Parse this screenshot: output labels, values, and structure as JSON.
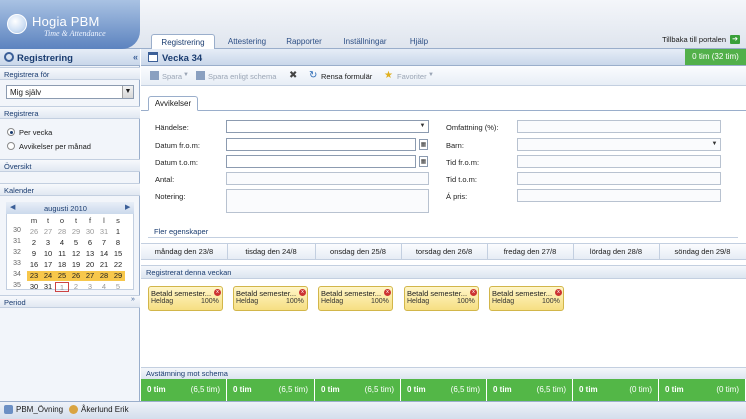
{
  "app": {
    "name": "Hogia PBM",
    "subtitle": "Time & Attendance",
    "tabs": [
      "Registrering",
      "Attestering",
      "Rapporter",
      "Inställningar",
      "Hjälp"
    ],
    "back_link": "Tillbaka till portalen"
  },
  "sidebar": {
    "title": "Registrering",
    "section_registrera_for": "Registrera för",
    "select_value": "Mig själv",
    "section_registrera": "Registrera",
    "radio_per_vecka": "Per vecka",
    "radio_avvikelser": "Avvikelser per månad",
    "section_oversikt": "Översikt",
    "section_kalender": "Kalender",
    "section_period": "Period",
    "calendar": {
      "month": "augusti 2010",
      "weekdays": [
        "m",
        "t",
        "o",
        "t",
        "f",
        "l",
        "s"
      ],
      "weeks": [
        {
          "wk": "30",
          "days": [
            "26",
            "27",
            "28",
            "29",
            "30",
            "31",
            "1"
          ]
        },
        {
          "wk": "31",
          "days": [
            "2",
            "3",
            "4",
            "5",
            "6",
            "7",
            "8"
          ]
        },
        {
          "wk": "32",
          "days": [
            "9",
            "10",
            "11",
            "12",
            "13",
            "14",
            "15"
          ]
        },
        {
          "wk": "33",
          "days": [
            "16",
            "17",
            "18",
            "19",
            "20",
            "21",
            "22"
          ]
        },
        {
          "wk": "34",
          "days": [
            "23",
            "24",
            "25",
            "26",
            "27",
            "28",
            "29"
          ]
        },
        {
          "wk": "35",
          "days": [
            "30",
            "31",
            "1",
            "2",
            "3",
            "4",
            "5"
          ]
        }
      ]
    }
  },
  "main": {
    "title": "Vecka 34",
    "total": "0 tim (32 tim)",
    "toolbar": {
      "spara": "Spara",
      "spara_schema": "Spara enligt schema",
      "rensa": "Rensa formulär",
      "favoriter": "Favoriter"
    },
    "subtab": "Avvikelser",
    "form": {
      "handelse": "Händelse:",
      "datum_from": "Datum fr.o.m:",
      "datum_tom": "Datum t.o.m:",
      "antal": "Antal:",
      "notering": "Notering:",
      "omfattning": "Omfattning (%):",
      "barn": "Barn:",
      "tid_from": "Tid fr.o.m:",
      "tid_tom": "Tid t.o.m:",
      "a_pris": "Á pris:"
    },
    "fler": "Fler egenskaper",
    "days": [
      "måndag den 23/8",
      "tisdag den 24/8",
      "onsdag den 25/8",
      "torsdag den 26/8",
      "fredag den 27/8",
      "lördag den 28/8",
      "söndag den 29/8"
    ],
    "registered_header": "Registrerat denna veckan",
    "cards": [
      {
        "title": "Betald semester...",
        "type": "Heldag",
        "pct": "100%"
      },
      {
        "title": "Betald semester...",
        "type": "Heldag",
        "pct": "100%"
      },
      {
        "title": "Betald semester...",
        "type": "Heldag",
        "pct": "100%"
      },
      {
        "title": "Betald semester...",
        "type": "Heldag",
        "pct": "100%"
      },
      {
        "title": "Betald semester...",
        "type": "Heldag",
        "pct": "100%"
      }
    ],
    "avst_header": "Avstämning mot schema",
    "avst": [
      {
        "a": "0 tim",
        "b": "(6,5 tim)"
      },
      {
        "a": "0 tim",
        "b": "(6,5 tim)"
      },
      {
        "a": "0 tim",
        "b": "(6,5 tim)"
      },
      {
        "a": "0 tim",
        "b": "(6,5 tim)"
      },
      {
        "a": "0 tim",
        "b": "(6,5 tim)"
      },
      {
        "a": "0 tim",
        "b": "(0 tim)"
      },
      {
        "a": "0 tim",
        "b": "(0 tim)"
      }
    ]
  },
  "footer": {
    "company": "PBM_Övning",
    "user": "Åkerlund Erik"
  },
  "colors": {
    "accent": "#1a3c70",
    "green": "#53b747",
    "card": "#f6df82",
    "selected_week": "#f7c74b"
  }
}
